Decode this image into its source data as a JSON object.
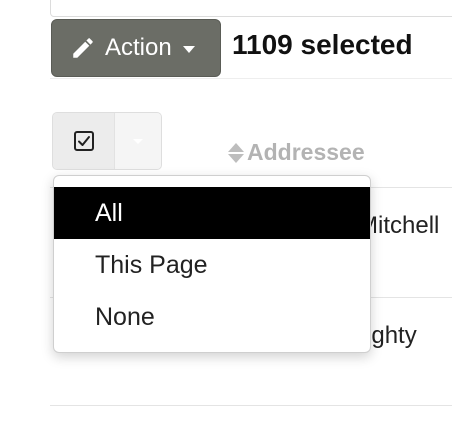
{
  "toolbar": {
    "action_label": "Action",
    "selected_text": "1109 selected"
  },
  "table": {
    "column_header": "Addressee",
    "rows": [
      "Mitchell",
      "ughty"
    ]
  },
  "select_menu": {
    "items": [
      "All",
      "This Page",
      "None"
    ],
    "active_item": "All"
  },
  "colors": {
    "action_button_bg": "#6b6d66",
    "menu_active_bg": "#000000",
    "column_header_text": "#b3b3b3"
  },
  "icons": [
    "pencil-icon",
    "caret-down-icon",
    "checkbox-checked-icon",
    "sort-icon"
  ]
}
